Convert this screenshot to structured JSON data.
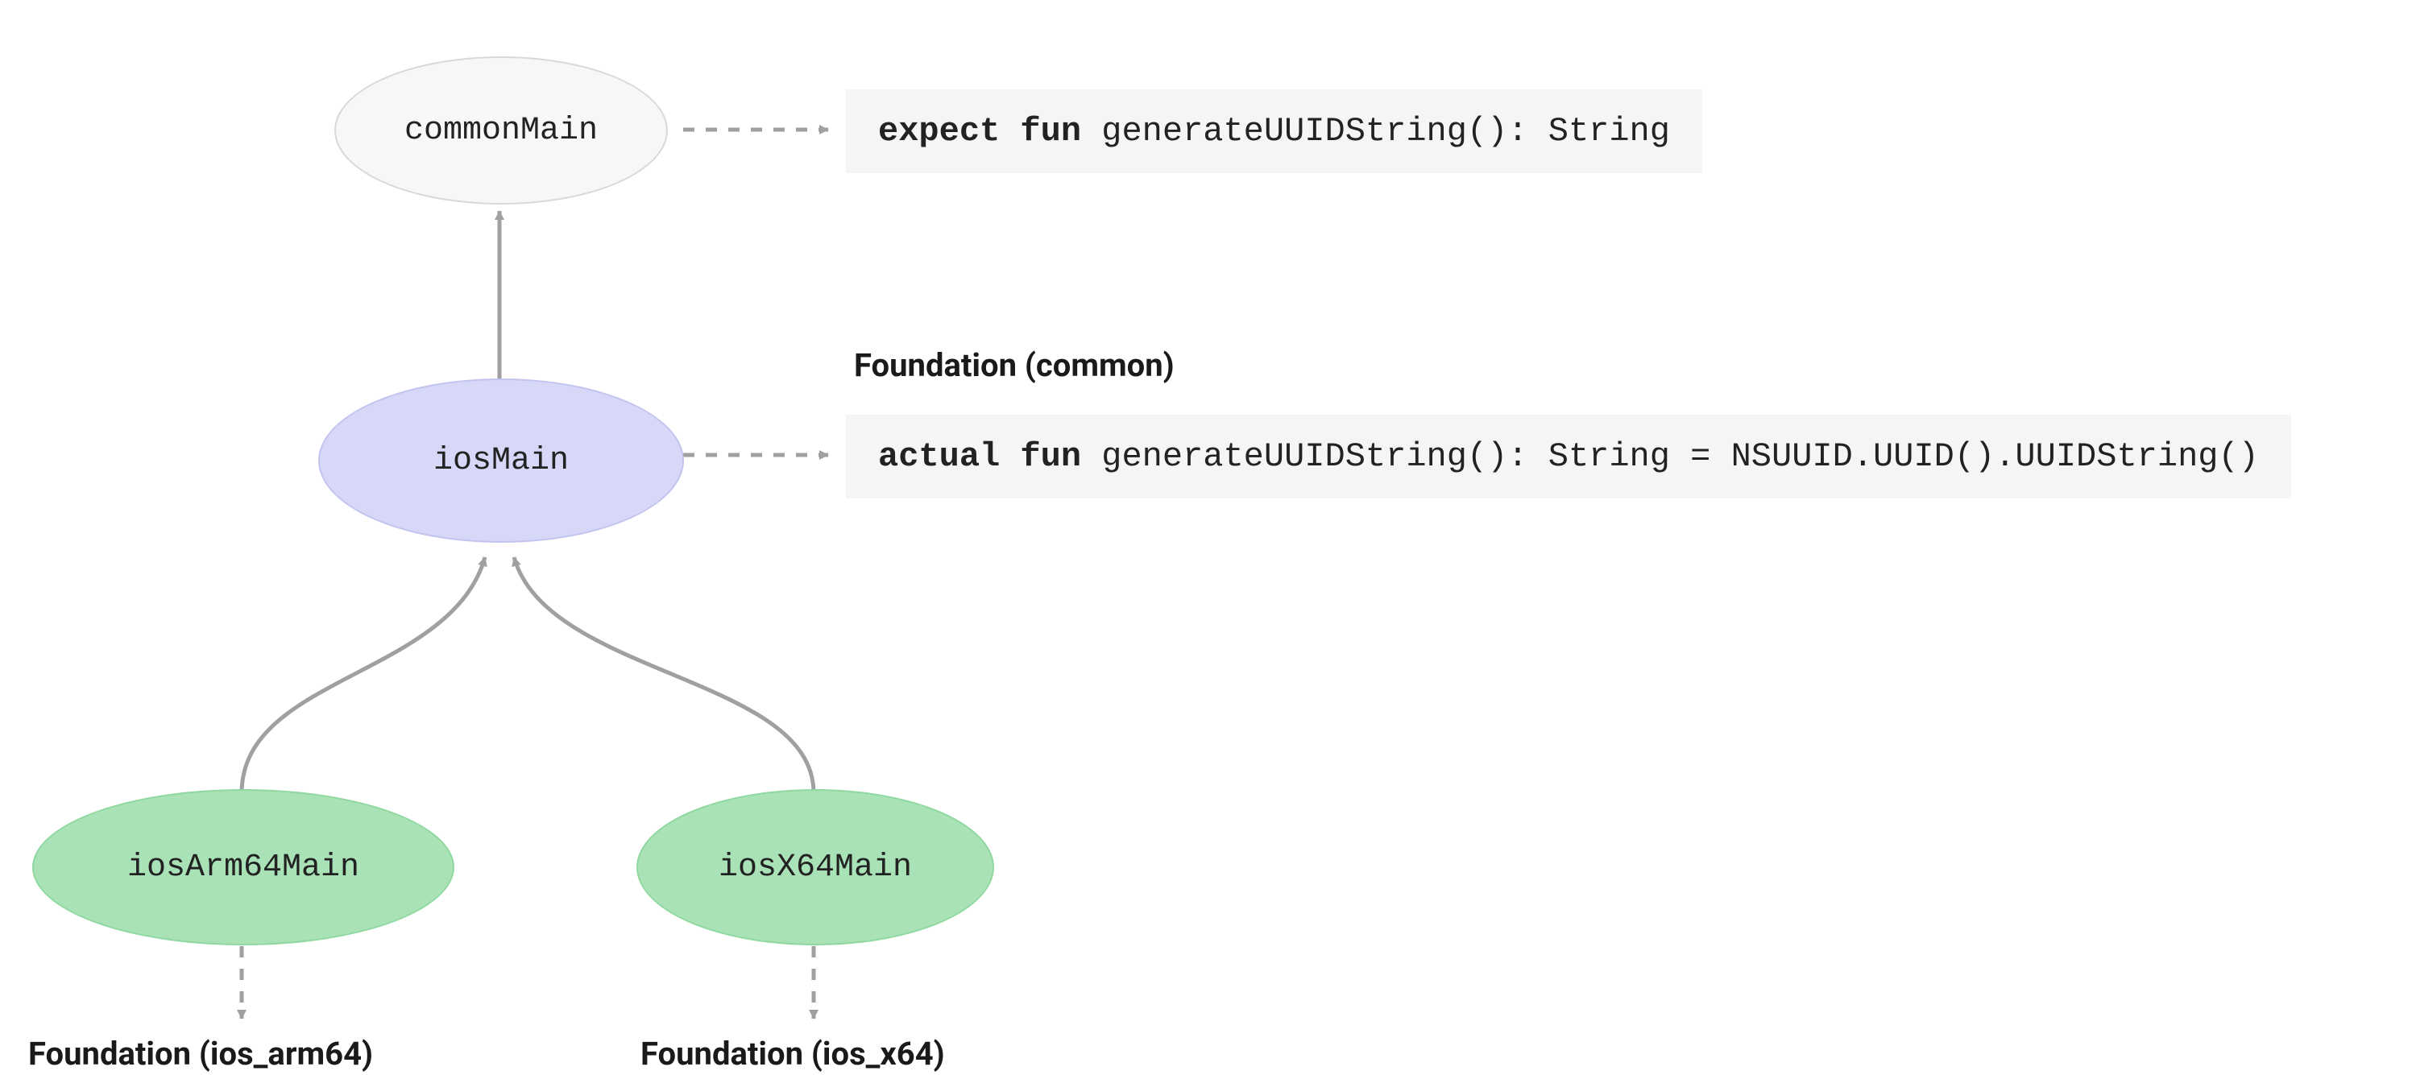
{
  "nodes": {
    "commonMain": "commonMain",
    "iosMain": "iosMain",
    "iosArm64Main": "iosArm64Main",
    "iosX64Main": "iosX64Main"
  },
  "code": {
    "expect_kw": "expect fun",
    "expect_rest": " generateUUIDString(): String",
    "actual_kw": "actual fun",
    "actual_rest": " generateUUIDString(): String = NSUUID.UUID().UUIDString()"
  },
  "labels": {
    "foundation_common": "Foundation (common)",
    "foundation_arm64": "Foundation (ios_arm64)",
    "foundation_x64": "Foundation (ios_x64)"
  },
  "colors": {
    "gray_fill": "#f7f7f8",
    "purple_fill": "#d7d8f7",
    "green_fill": "#a9e2b6",
    "code_bg": "#f4f5f6",
    "arrow": "#a0a0a0"
  }
}
